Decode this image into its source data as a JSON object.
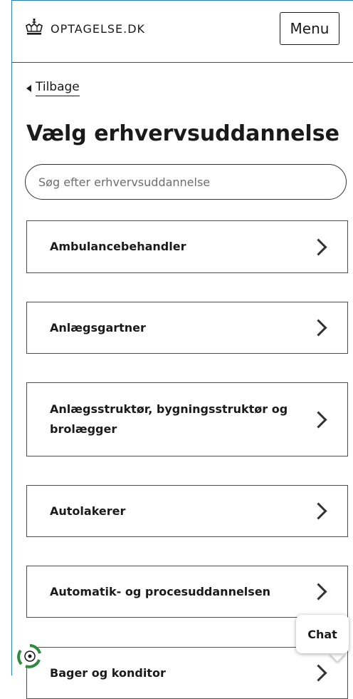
{
  "header": {
    "logo_text": "OPTAGELSE.DK",
    "menu_label": "Menu"
  },
  "nav": {
    "back_label": "Tilbage"
  },
  "page": {
    "title": "Vælg erhvervsuddannelse"
  },
  "search": {
    "placeholder": "Søg efter erhvervsuddannelse"
  },
  "items": [
    {
      "label": "Ambulancebehandler"
    },
    {
      "label": "Anlægsgartner"
    },
    {
      "label": "Anlægsstruktør, bygningsstruktør og brolægger"
    },
    {
      "label": "Autolakerer"
    },
    {
      "label": "Automatik- og procesuddannelsen"
    },
    {
      "label": "Bager og konditor"
    }
  ],
  "chat": {
    "label": "Chat"
  },
  "colors": {
    "frame": "#2a7fb0",
    "text": "#1a1a1a",
    "chat_icon": "#2e8b3e"
  }
}
